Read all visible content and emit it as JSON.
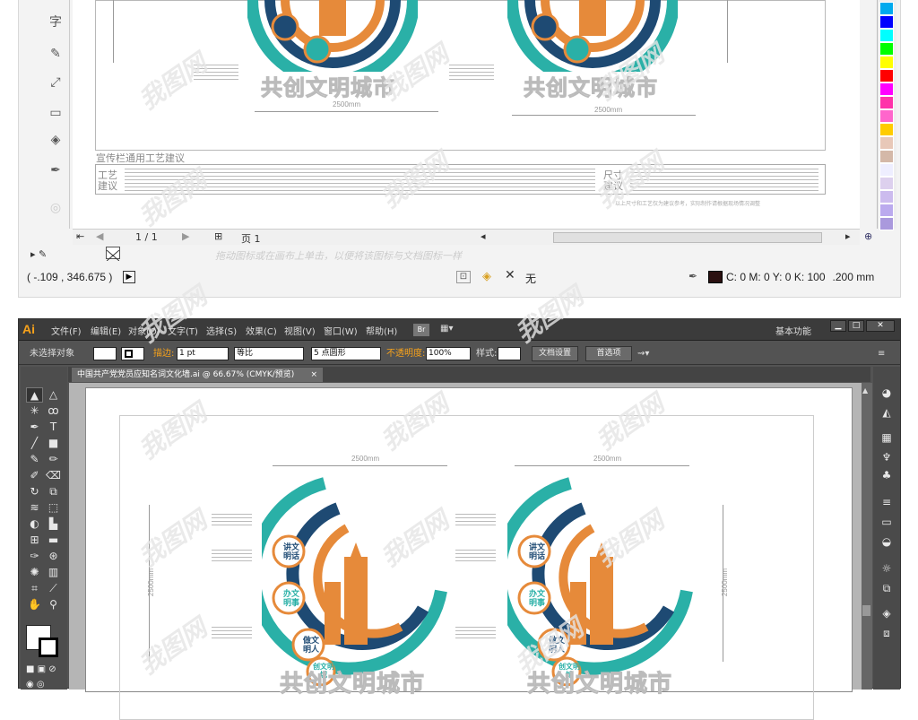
{
  "top": {
    "title_section": "宣传栏通用工艺建议",
    "craft_label": "工艺建议",
    "size_label": "尺寸建议",
    "dim_width": "2500mm",
    "slogan": "共创文明城市",
    "note": "以上尺寸和工艺仅为建议参考，实际制作请根据现场情况调整",
    "page_value": "1 / 1",
    "page_label": "页 1",
    "hint": "拖动图标或在画布上单击，以便将该图标与文档图标一样",
    "coord": "( -.109 , 346.675 )",
    "fill_label": "无",
    "color_info": "C: 0 M: 0 Y: 0 K: 100",
    "stroke_info": ".200 mm",
    "zoom_icon": "zoom-icon",
    "swatch_colors": [
      "#00aaee",
      "#0000ff",
      "#00ffff",
      "#00ff00",
      "#ffff00",
      "#ff0000",
      "#ff00ff",
      "#ff33aa",
      "#ff66cc",
      "#ffcc00",
      "#e8c8b8",
      "#d4b8a8",
      "#eeeeff",
      "#ddd0ee",
      "#ccbbee",
      "#bbaaee",
      "#aa99dd"
    ]
  },
  "app": {
    "logo": "Ai",
    "menus": [
      "文件(F)",
      "编辑(E)",
      "对象(O)",
      "文字(T)",
      "选择(S)",
      "效果(C)",
      "视图(V)",
      "窗口(W)",
      "帮助(H)"
    ],
    "br": "Br",
    "workspace": "基本功能",
    "ctrl": {
      "no_selection": "未选择对象",
      "stroke_label": "描边:",
      "stroke_value": "1 pt",
      "profile": "等比",
      "brush": "5 点圆形",
      "opacity_label": "不透明度:",
      "opacity_value": "100%",
      "style_label": "样式:",
      "doc_setup": "文档设置",
      "preferences": "首选项"
    },
    "doc_tab": "中国共产党党员应知名词文化墙.ai @ 66.67% (CMYK/预览)",
    "doc_close": "×",
    "canvas_dim_w": "2500mm",
    "canvas_dim_h": "2500mm",
    "badges": [
      "讲文明话",
      "办文明事",
      "做文明人",
      "创文明城"
    ],
    "slogan": "共创文明城市"
  },
  "watermark": "我图网"
}
